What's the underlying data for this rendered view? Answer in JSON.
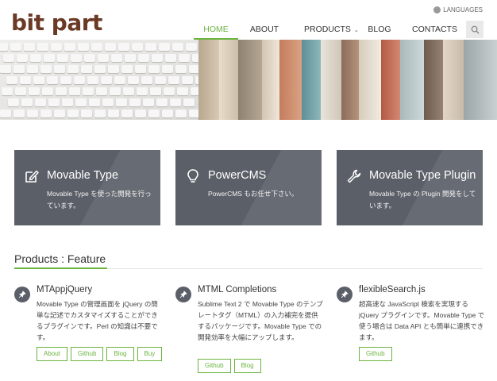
{
  "brand": {
    "logo_text": "bit part",
    "color": "#6b3a26"
  },
  "header": {
    "languages_label": "LANGUAGES",
    "nav": {
      "home": "HOME",
      "about": "ABOUT",
      "products": "PRODUCTS",
      "blog": "BLOG",
      "contacts": "CONTACTS"
    },
    "active_item": "HOME",
    "accent_color": "#6cb33f"
  },
  "features": [
    {
      "icon": "edit-icon",
      "title": "Movable Type",
      "description": "Movable Type を使った開発を行っています。"
    },
    {
      "icon": "lightbulb-icon",
      "title": "PowerCMS",
      "description": "PowerCMS もお任せ下さい。"
    },
    {
      "icon": "wrench-icon",
      "title": "Movable Type Plugin",
      "description": "Movable Type の Plugin 開発をしています。"
    }
  ],
  "section": {
    "title": "Products : Feature"
  },
  "products": [
    {
      "name": "MTAppjQuery",
      "description": "Movable Type の管理画面を jQuery の簡単な記述でカスタマイズすることができるプラグインです。Perl の知識は不要です。",
      "tags": [
        "About",
        "Github",
        "Blog",
        "Buy"
      ]
    },
    {
      "name": "MTML Completions",
      "description": "Sublime Text 2 で Movable Type のテンプレートタグ（MTML）の入力補完を提供するパッケージです。Movable Type での開発効率を大幅にアップします。",
      "tags": [
        "Github",
        "Blog"
      ]
    },
    {
      "name": "flexibleSearch.js",
      "description": "超高速な JavaScript 検索を実現する jQuery プラグインです。Movable Type で使う場合は Data API とも簡単に連携できます。",
      "tags": [
        "Github"
      ]
    }
  ]
}
